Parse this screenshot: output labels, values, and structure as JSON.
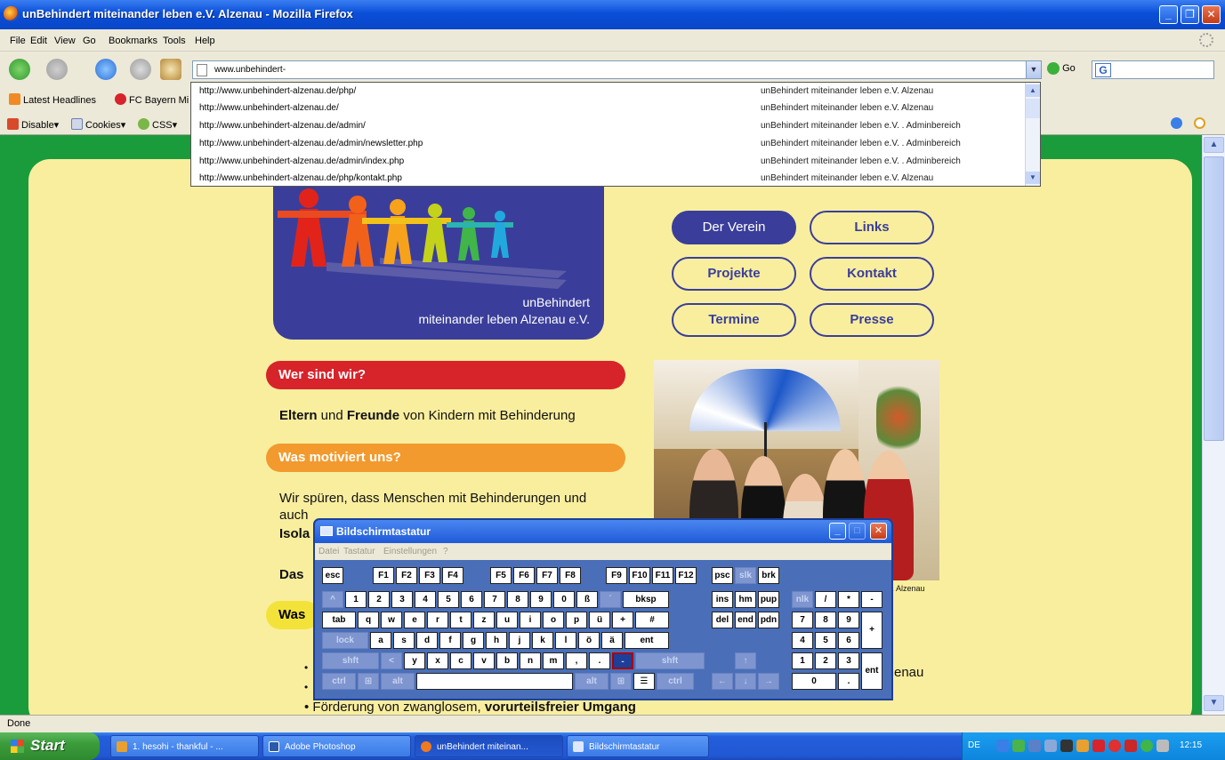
{
  "window": {
    "title": "unBehindert miteinander leben e.V. Alzenau - Mozilla Firefox"
  },
  "menu": [
    "File",
    "Edit",
    "View",
    "Go",
    "Bookmarks",
    "Tools",
    "Help"
  ],
  "nav": {
    "url": "www.unbehindert-",
    "go_label": "Go"
  },
  "bookmarks": [
    "Latest Headlines",
    "FC Bayern Mi"
  ],
  "webdev": [
    "Disable▾",
    "Cookies▾",
    "CSS▾"
  ],
  "autocomplete": [
    {
      "url": "http://www.unbehindert-alzenau.de/php/",
      "title": "unBehindert miteinander leben e.V. Alzenau"
    },
    {
      "url": "http://www.unbehindert-alzenau.de/",
      "title": "unBehindert miteinander leben e.V. Alzenau"
    },
    {
      "url": "http://www.unbehindert-alzenau.de/admin/",
      "title": "unBehindert miteinander leben e.V. . Adminbereich"
    },
    {
      "url": "http://www.unbehindert-alzenau.de/admin/newsletter.php",
      "title": "unBehindert miteinander leben e.V. . Adminbereich"
    },
    {
      "url": "http://www.unbehindert-alzenau.de/admin/index.php",
      "title": "unBehindert miteinander leben e.V. . Adminbereich"
    },
    {
      "url": "http://www.unbehindert-alzenau.de/php/kontakt.php",
      "title": "unBehindert miteinander leben e.V. Alzenau"
    }
  ],
  "page": {
    "logo_line1": "unBehindert",
    "logo_line2": "miteinander leben Alzenau e.V.",
    "nav_buttons": [
      "Der Verein",
      "Links",
      "Projekte",
      "Kontakt",
      "Termine",
      "Presse"
    ],
    "section1_title": "Wer sind wir?",
    "section1_b1": "Eltern",
    "section1_t1": " und ",
    "section1_b2": "Freunde",
    "section1_t2": " von Kindern mit Behinderung",
    "section2_title": "Was motiviert uns?",
    "section2_line1": "Wir spüren, dass Menschen mit Behinderungen und",
    "section2_line2": "auch",
    "section2_line3": "Isola",
    "section3_start": "Das",
    "section4_start": "Was",
    "photo_caption": "/. Alzenau",
    "bullet_tail": "enau",
    "bullet_last_a": "Förderung von zwanglosem, ",
    "bullet_last_b": "vorurteilsfreier Umgang"
  },
  "osk": {
    "title": "Bildschirmtastatur",
    "menu": [
      "Datei",
      "Tastatur",
      "Einstellungen",
      "?"
    ]
  },
  "status": "Done",
  "taskbar": {
    "start": "Start",
    "tasks": [
      "1. hesohi - thankful - ...",
      "Adobe Photoshop",
      "unBehindert miteinan...",
      "Bildschirmtastatur"
    ],
    "lang": "DE",
    "clock": "12:15"
  }
}
